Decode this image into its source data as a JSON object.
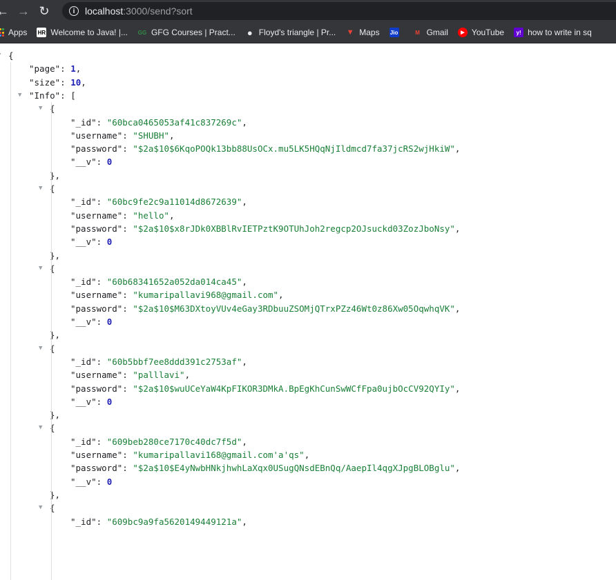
{
  "browser": {
    "url_host": "localhost",
    "url_path": ":3000/send?sort",
    "bookmarks": [
      {
        "label": "Apps",
        "icon": "apps-grid-icon"
      },
      {
        "label": "Welcome to Java! |...",
        "icon": "java-icon",
        "badge": "HR"
      },
      {
        "label": "GFG Courses | Pract...",
        "icon": "gfg-icon",
        "badge": "GG"
      },
      {
        "label": "Floyd's triangle | Pr...",
        "icon": "globe-icon"
      },
      {
        "label": "Maps",
        "icon": "maps-icon"
      },
      {
        "label": "",
        "icon": "jio-icon",
        "badge": "Jio"
      },
      {
        "label": "Gmail",
        "icon": "gmail-icon",
        "badge": "M"
      },
      {
        "label": "YouTube",
        "icon": "youtube-icon"
      },
      {
        "label": "how to write in sq",
        "icon": "yahoo-icon",
        "badge": "y!"
      }
    ]
  },
  "json": {
    "page": 1,
    "size": 10,
    "info_key": "Info",
    "records": [
      {
        "_id": "60bca0465053af41c837269c",
        "username": "SHUBH",
        "password": "$2a$10$6KqoPOQk13bb88UsOCx.mu5LK5HQqNjIldmcd7fa37jcRS2wjHkiW",
        "__v": 0
      },
      {
        "_id": "60bc9fe2c9a11014d8672639",
        "username": "hello",
        "password": "$2a$10$x8rJDk0XBBlRvIETPztK9OTUhJoh2regcp2OJsuckd03ZozJboNsy",
        "__v": 0
      },
      {
        "_id": "60b68341652a052da014ca45",
        "username": "kumaripallavi968@gmail.com",
        "password": "$2a$10$M63DXtoyVUv4eGay3RDbuuZSOMjQTrxPZz46Wt0z86Xw05OqwhqVK",
        "__v": 0
      },
      {
        "_id": "60b5bbf7ee8ddd391c2753af",
        "username": "palllavi",
        "password": "$2a$10$wuUCeYaW4KpFIKOR3DMkA.BpEgKhCunSwWCfFpa0ujbOcCV92QYIy",
        "__v": 0
      },
      {
        "_id": "609beb280ce7170c40dc7f5d",
        "username": "kumaripallavi168@gmail.com'a'qs",
        "password": "$2a$10$E4yNwbHNkjhwhLaXqx0USugQNsdEBnQq/AaepIl4qgXJpgBLOBglu",
        "__v": 0
      },
      {
        "_id": "609bc9a9fa5620149449121a"
      }
    ]
  },
  "colors": {
    "chrome_bg": "#35363a",
    "omnibox_bg": "#202124",
    "json_string": "#1a7f37",
    "json_number": "#1f1fb5"
  }
}
